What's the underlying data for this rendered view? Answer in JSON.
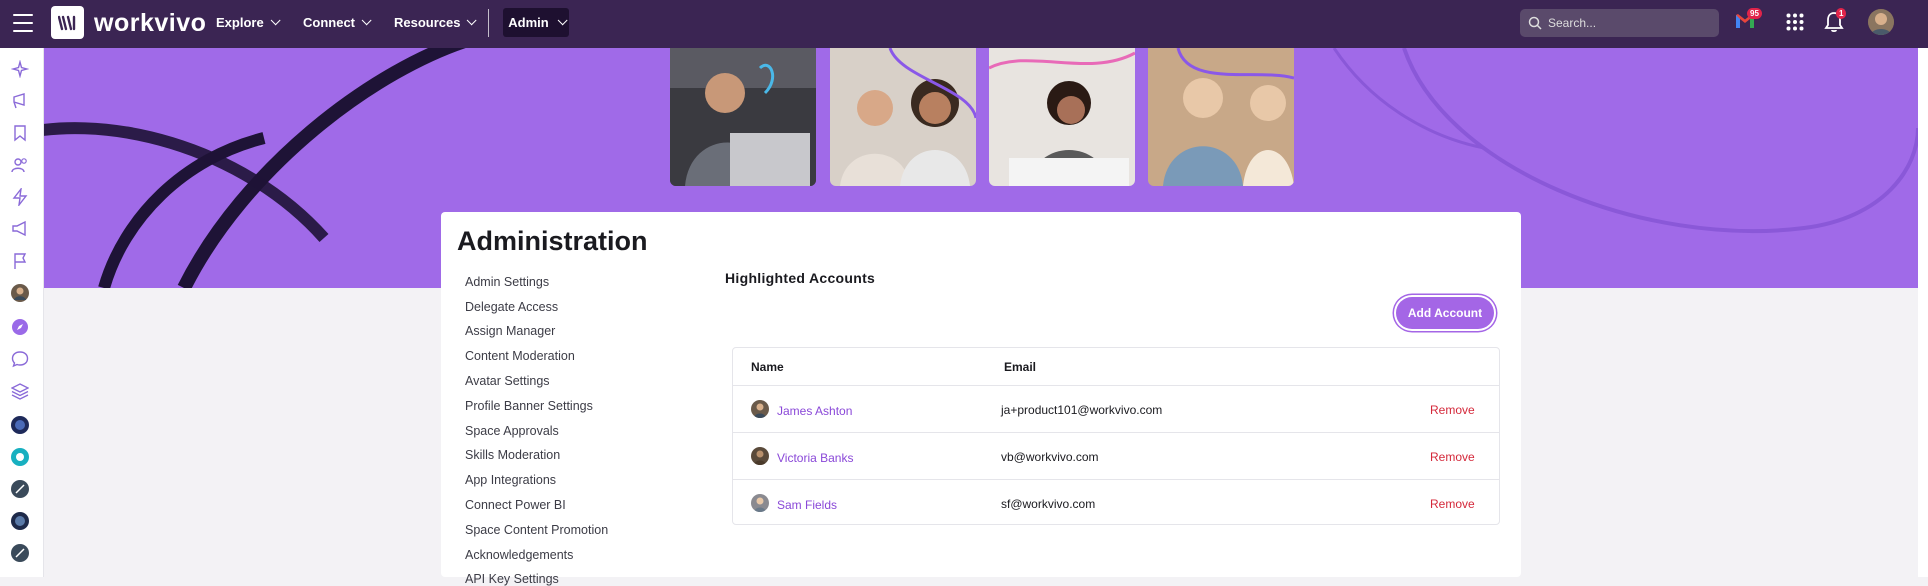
{
  "topbar": {
    "logo": "workvivo",
    "nav": [
      "Explore",
      "Connect",
      "Resources"
    ],
    "admin_label": "Admin",
    "search_placeholder": "Search...",
    "mail_badge": "95",
    "notification_badge": "1"
  },
  "page": {
    "title": "Administration",
    "menu": [
      "Admin Settings",
      "Delegate Access",
      "Assign Manager",
      "Content Moderation",
      "Avatar Settings",
      "Profile Banner Settings",
      "Space Approvals",
      "Skills Moderation",
      "App Integrations",
      "Connect Power BI",
      "Space Content Promotion",
      "Acknowledgements",
      "API Key Settings"
    ],
    "section_title": "Highlighted Accounts",
    "add_button": "Add Account",
    "table": {
      "headers": [
        "Name",
        "Email"
      ],
      "rows": [
        {
          "name": "James Ashton",
          "email": "ja+product101@workvivo.com",
          "action": "Remove"
        },
        {
          "name": "Victoria Banks",
          "email": "vb@workvivo.com",
          "action": "Remove"
        },
        {
          "name": "Sam Fields",
          "email": "sf@workvivo.com",
          "action": "Remove"
        }
      ]
    }
  },
  "colors": {
    "topbar": "#3b2553",
    "banner": "#a06ae8",
    "accent": "#a466e6",
    "link": "#8a48d8",
    "danger": "#d4283a"
  }
}
